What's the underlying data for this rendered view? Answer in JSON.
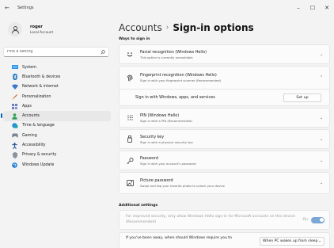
{
  "window": {
    "title": "Settings",
    "back_glyph": "←",
    "minimize_glyph": "–",
    "maximize_glyph": "☐",
    "close_glyph": "✕"
  },
  "profile": {
    "name": "roger",
    "account_type": "Local Account"
  },
  "search": {
    "placeholder": "Find a setting"
  },
  "sidebar": {
    "items": [
      {
        "label": "System",
        "icon": "monitor-icon"
      },
      {
        "label": "Bluetooth & devices",
        "icon": "bluetooth-icon"
      },
      {
        "label": "Network & internet",
        "icon": "wifi-icon"
      },
      {
        "label": "Personalization",
        "icon": "brush-icon"
      },
      {
        "label": "Apps",
        "icon": "apps-icon"
      },
      {
        "label": "Accounts",
        "icon": "accounts-icon",
        "active": true
      },
      {
        "label": "Time & language",
        "icon": "globe-clock-icon"
      },
      {
        "label": "Gaming",
        "icon": "gamepad-icon"
      },
      {
        "label": "Accessibility",
        "icon": "accessibility-icon"
      },
      {
        "label": "Privacy & security",
        "icon": "shield-icon"
      },
      {
        "label": "Windows Update",
        "icon": "update-icon"
      }
    ]
  },
  "header": {
    "breadcrumb_parent": "Accounts",
    "separator": "›",
    "title": "Sign-in options"
  },
  "ways_to_sign_in": {
    "label": "Ways to sign in",
    "options": [
      {
        "title": "Facial recognition (Windows Hello)",
        "subtitle": "This option is currently unavailable",
        "icon": "face-icon",
        "expanded": false
      },
      {
        "title": "Fingerprint recognition (Windows Hello)",
        "subtitle": "Sign in with your fingerprint scanner (Recommended)",
        "icon": "fingerprint-icon",
        "expanded": true
      },
      {
        "title": "PIN (Windows Hello)",
        "subtitle": "Sign in with a PIN (Recommended)",
        "icon": "pin-icon",
        "expanded": false
      },
      {
        "title": "Security key",
        "subtitle": "Sign in with a physical security key",
        "icon": "usb-key-icon",
        "expanded": false
      },
      {
        "title": "Password",
        "subtitle": "Sign in with your account's password",
        "icon": "key-icon",
        "expanded": false
      },
      {
        "title": "Picture password",
        "subtitle": "Swipe and tap your favorite photo to unlock your device",
        "icon": "picture-icon",
        "expanded": false
      }
    ],
    "fingerprint_expanded": {
      "label": "Sign in with Windows, apps, and services",
      "button_label": "Set up"
    }
  },
  "additional_settings": {
    "label": "Additional settings",
    "hello_only": {
      "text": "For improved security, only allow Windows Hello sign-in for Microsoft accounts on this device (Recommended)",
      "state_label": "On",
      "enabled": true,
      "disabled_appearance": true
    },
    "require_signin": {
      "text": "If you've been away, when should Windows require you to",
      "selected": "When PC wakes up from sleep",
      "chevron": "⌄"
    }
  },
  "colors": {
    "accent": "#0067c0",
    "background": "#f3f3f3",
    "card": "#fbfbfb"
  }
}
